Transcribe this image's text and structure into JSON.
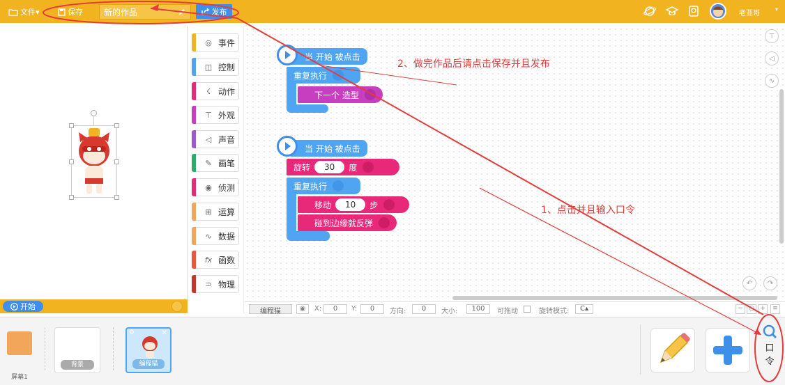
{
  "topbar": {
    "file_label": "文件▾",
    "save_label": "保存",
    "project_title": "新的作品",
    "publish_label": "发布",
    "username": "老亚哥"
  },
  "categories": [
    {
      "label": "事件",
      "color": "#F2B320",
      "icon": "toggle-icon"
    },
    {
      "label": "控制",
      "color": "#4FA5F2",
      "icon": "gamepad-icon"
    },
    {
      "label": "动作",
      "color": "#E8297A",
      "icon": "running-icon"
    },
    {
      "label": "外观",
      "color": "#C83EC0",
      "icon": "shirt-icon"
    },
    {
      "label": "声音",
      "color": "#9B59D0",
      "icon": "speaker-icon"
    },
    {
      "label": "画笔",
      "color": "#2EAA6A",
      "icon": "brush-icon"
    },
    {
      "label": "侦测",
      "color": "#E8297A",
      "icon": "radar-icon"
    },
    {
      "label": "运算",
      "color": "#F2A65A",
      "icon": "calc-icon"
    },
    {
      "label": "数据",
      "color": "#F2A65A",
      "icon": "chart-icon"
    },
    {
      "label": "函数",
      "color": "#E8573A",
      "icon": "fx-icon"
    },
    {
      "label": "物理",
      "color": "#C0392B",
      "icon": "magnet-icon"
    }
  ],
  "script1": {
    "hat": "当 开始 被点击",
    "repeat": "重复执行",
    "next_costume": "下一个 造型"
  },
  "script2": {
    "hat": "当 开始 被点击",
    "turn_pre": "旋转",
    "turn_value": "30",
    "turn_post": "度",
    "repeat": "重复执行",
    "move_pre": "移动",
    "move_value": "10",
    "move_post": "步",
    "bounce": "碰到边缘就反弹"
  },
  "annotations": {
    "a2": "2、做完作品后请点击保存并且发布",
    "a1": "1、点击并且输入口令"
  },
  "stage": {
    "start_label": "开始"
  },
  "props": {
    "sprite_name": "编程猫",
    "x_label": "X:",
    "x_value": "0",
    "y_label": "Y:",
    "y_value": "0",
    "dir_label": "方向:",
    "dir_value": "0",
    "size_label": "大小:",
    "size_value": "100",
    "drag_label": "可拖动",
    "rotate_label": "旋转模式:"
  },
  "tray": {
    "screen_label": "屏幕1",
    "bg_label": "背景",
    "sprite_label": "编程猫",
    "code_btn_line1": "口",
    "code_btn_line2": "令"
  },
  "colors": {
    "accent": "#F2B320",
    "blue": "#3E8FE8",
    "annotation": "#E53B3B"
  }
}
